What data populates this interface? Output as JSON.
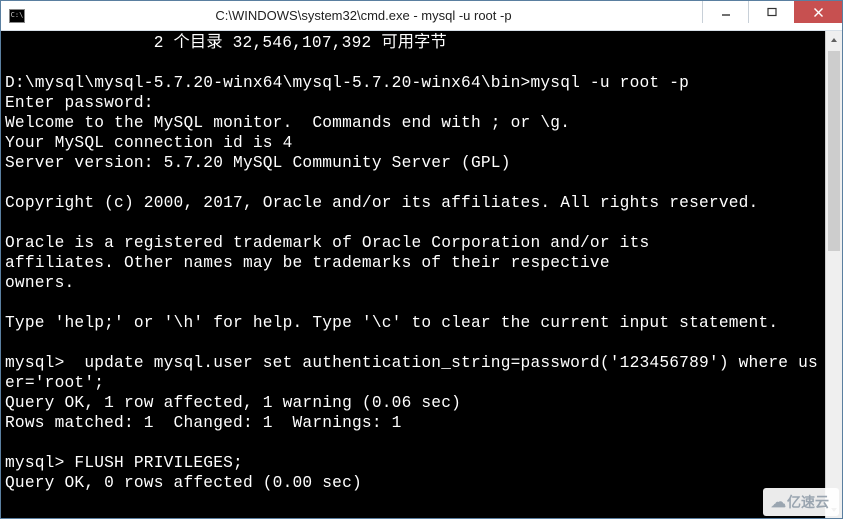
{
  "window": {
    "title": "C:\\WINDOWS\\system32\\cmd.exe - mysql  -u root -p"
  },
  "terminal": {
    "lines": [
      "               2 个目录 32,546,107,392 可用字节",
      "",
      "D:\\mysql\\mysql-5.7.20-winx64\\mysql-5.7.20-winx64\\bin>mysql -u root -p",
      "Enter password:",
      "Welcome to the MySQL monitor.  Commands end with ; or \\g.",
      "Your MySQL connection id is 4",
      "Server version: 5.7.20 MySQL Community Server (GPL)",
      "",
      "Copyright (c) 2000, 2017, Oracle and/or its affiliates. All rights reserved.",
      "",
      "Oracle is a registered trademark of Oracle Corporation and/or its",
      "affiliates. Other names may be trademarks of their respective",
      "owners.",
      "",
      "Type 'help;' or '\\h' for help. Type '\\c' to clear the current input statement.",
      "",
      "mysql>  update mysql.user set authentication_string=password('123456789') where user='root';",
      "Query OK, 1 row affected, 1 warning (0.06 sec)",
      "Rows matched: 1  Changed: 1  Warnings: 1",
      "",
      "mysql> FLUSH PRIVILEGES;",
      "Query OK, 0 rows affected (0.00 sec)"
    ]
  },
  "watermark": {
    "text": "亿速云"
  }
}
